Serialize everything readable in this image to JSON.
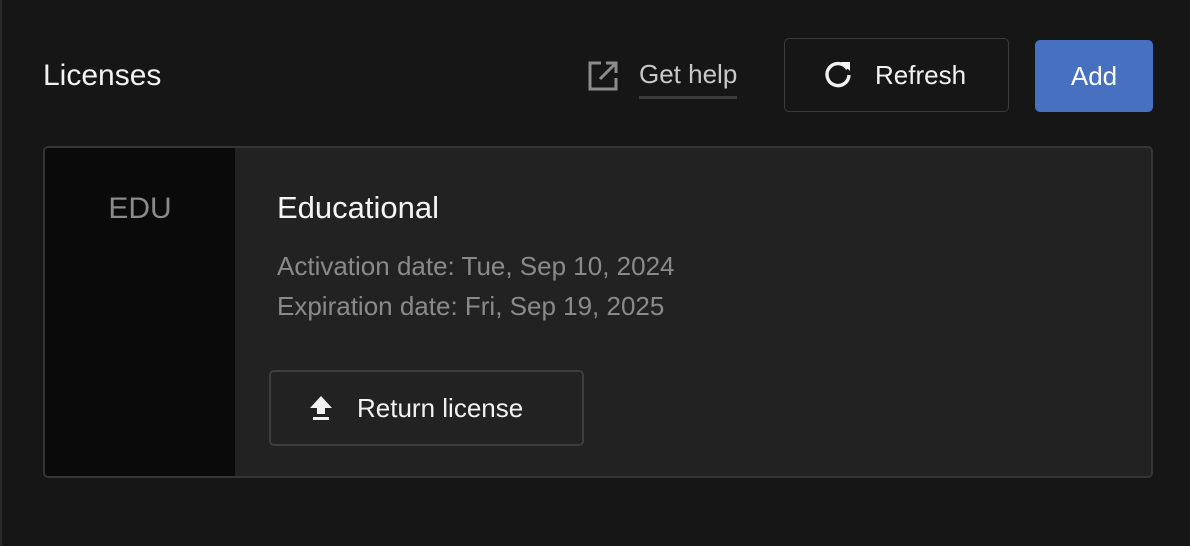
{
  "header": {
    "title": "Licenses",
    "help_label": "Get help",
    "refresh_label": "Refresh",
    "add_label": "Add"
  },
  "license": {
    "abbreviation": "EDU",
    "name": "Educational",
    "activation": "Activation date: Tue, Sep 10, 2024",
    "expiration": "Expiration date: Fri, Sep 19, 2025",
    "return_label": "Return license"
  },
  "icons": {
    "help": "external-link-icon",
    "refresh": "refresh-icon",
    "return": "upload-icon"
  },
  "colors": {
    "background": "#161616",
    "card": "#222222",
    "accent": "#4870c0"
  }
}
